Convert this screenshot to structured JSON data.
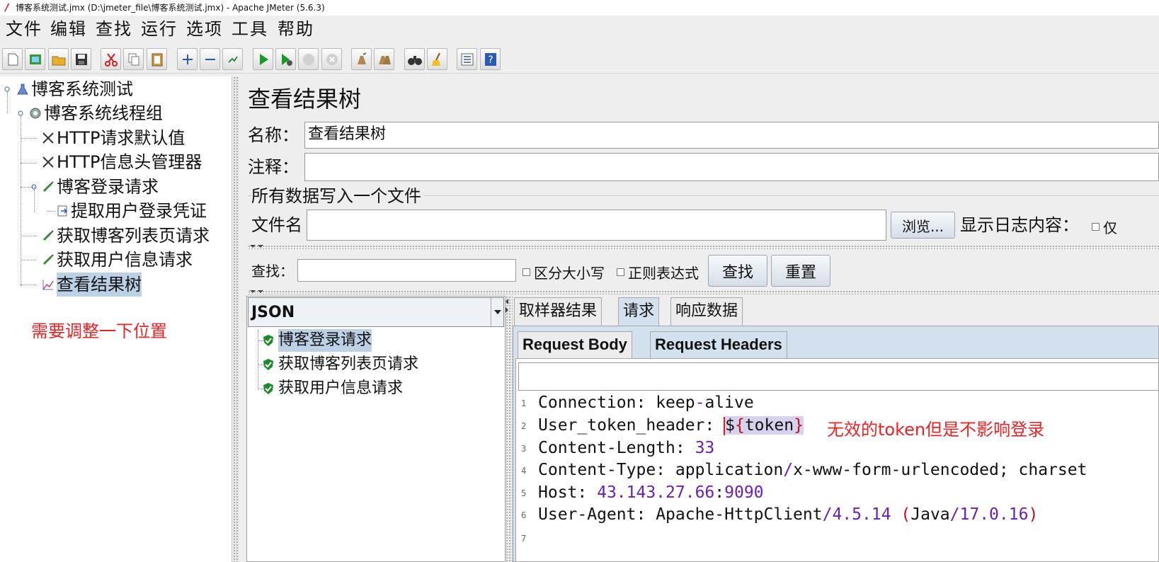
{
  "window": {
    "title": "博客系统测试.jmx (D:\\jmeter_file\\博客系统测试.jmx) - Apache JMeter (5.6.3)"
  },
  "menu": [
    "文件",
    "编辑",
    "查找",
    "运行",
    "选项",
    "工具",
    "帮助"
  ],
  "toolbar": {
    "icons": [
      "new-icon",
      "templates-icon",
      "open-icon",
      "save-icon",
      "cut-icon",
      "copy-icon",
      "paste-icon",
      "expand-icon",
      "collapse-icon",
      "toggle-icon",
      "start-icon",
      "start-no-pause-icon",
      "stop-icon",
      "shutdown-icon",
      "clear-icon",
      "clear-all-icon",
      "search-icon",
      "reset-search-icon",
      "function-helper-icon",
      "help-icon"
    ]
  },
  "tree": {
    "nodes": [
      {
        "label": "博客系统测试",
        "icon": "test-plan-icon"
      },
      {
        "label": "博客系统线程组",
        "icon": "thread-group-icon"
      },
      {
        "label": "HTTP请求默认值",
        "icon": "config-icon"
      },
      {
        "label": "HTTP信息头管理器",
        "icon": "config-icon"
      },
      {
        "label": "博客登录请求",
        "icon": "sampler-icon"
      },
      {
        "label": "提取用户登录凭证",
        "icon": "extractor-icon"
      },
      {
        "label": "获取博客列表页请求",
        "icon": "sampler-icon"
      },
      {
        "label": "获取用户信息请求",
        "icon": "sampler-icon"
      },
      {
        "label": "查看结果树",
        "icon": "listener-icon"
      }
    ],
    "annotation": "需要调整一下位置"
  },
  "panel": {
    "title": "查看结果树",
    "name_label": "名称：",
    "name_value": "查看结果树",
    "comment_label": "注释：",
    "comment_value": "",
    "file_group_title": "所有数据写入一个文件",
    "filename_label": "文件名",
    "filename_value": "",
    "browse_button": "浏览...",
    "log_content_label": "显示日志内容：",
    "log_option_partial": "仅"
  },
  "search": {
    "label": "查找：",
    "value": "",
    "case_sensitive": "区分大小写",
    "regex": "正则表达式",
    "find_button": "查找",
    "reset_button": "重置"
  },
  "results": {
    "renderer": "JSON",
    "items": [
      {
        "label": "博客登录请求",
        "status": "success",
        "selected": true
      },
      {
        "label": "获取博客列表页请求",
        "status": "success",
        "selected": false
      },
      {
        "label": "获取用户信息请求",
        "status": "success",
        "selected": false
      }
    ]
  },
  "tabs": {
    "main": [
      "取样器结果",
      "请求",
      "响应数据"
    ],
    "active_main": "请求",
    "sub": [
      "Request Body",
      "Request Headers"
    ],
    "active_sub": "Request Headers"
  },
  "headers": {
    "line_numbers": [
      "1",
      "2",
      "3",
      "4",
      "5",
      "6",
      "7"
    ],
    "l1": {
      "key": "Connection",
      "sep": ": ",
      "value_a": "keep",
      "dash": "-",
      "value_b": "alive"
    },
    "l2": {
      "key": "User_token_header",
      "sep": ": ",
      "dollar": "$",
      "open": "{",
      "token": "token",
      "close": "}"
    },
    "l3": {
      "key": "Content-Length",
      "sep": ": ",
      "value": "33"
    },
    "l4": {
      "key": "Content-Type",
      "sep": ": ",
      "value_a": "application",
      "slash": "/",
      "value_b": "x-www-form-urlencoded; charset"
    },
    "l5": {
      "key": "Host",
      "sep": ": ",
      "ip": "43.143.27.66",
      "colon": ":",
      "port": "9090"
    },
    "l6": {
      "key": "User-Agent",
      "sep": ": ",
      "client": "Apache-HttpClient",
      "slash": "/",
      "version": "4.5.14",
      "space": " ",
      "open": "(",
      "java": "Java",
      "slash2": "/",
      "jver": "17.0.16",
      "close": ")"
    },
    "annotation": "无效的token但是不影响登录"
  },
  "colors": {
    "selection": "#bcd0e6",
    "tab_active": "#d3e1ef",
    "annotation": "#ee2222",
    "number": "#6a1fb5",
    "paren": "#c0101b"
  }
}
